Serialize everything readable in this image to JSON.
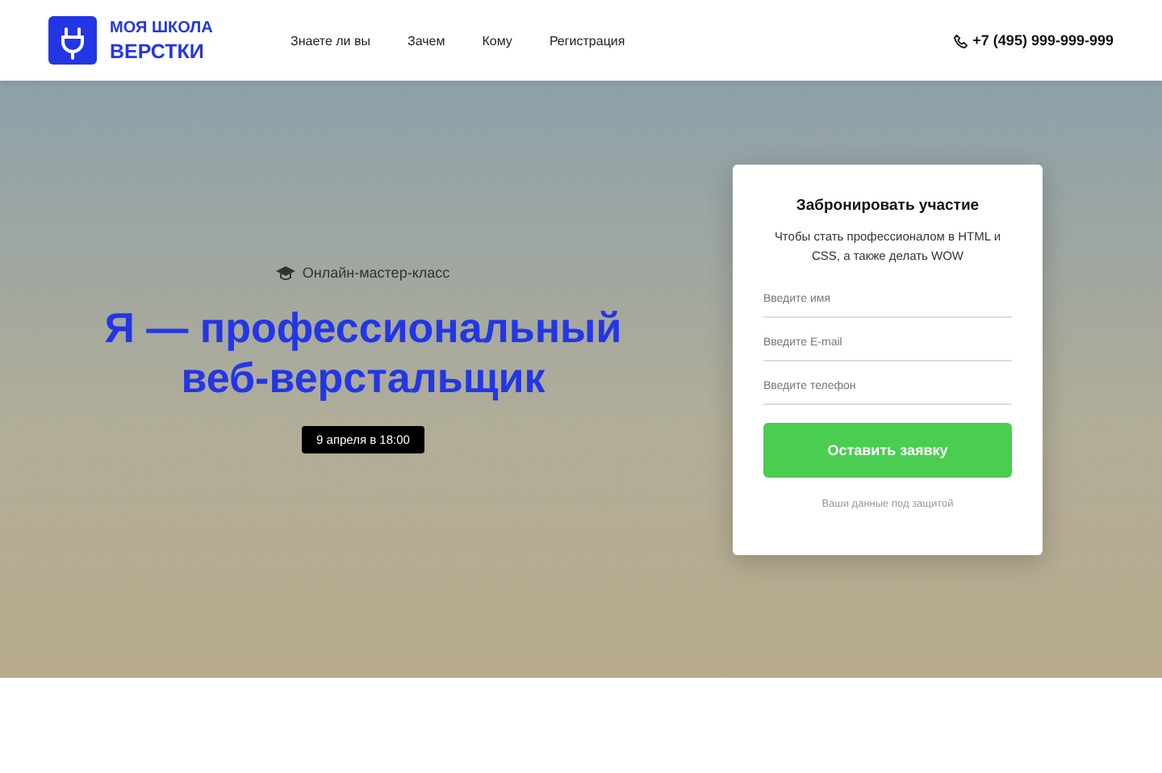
{
  "logo": {
    "line1": "МОЯ ШКОЛА",
    "line2": "ВЕРСТКИ"
  },
  "nav": [
    "Знаете ли вы",
    "Зачем",
    "Кому",
    "Регистрация"
  ],
  "phone": "+7 (495) 999-999-999",
  "hero": {
    "kicker": "Онлайн-мастер-класс",
    "title_line1": "Я — профессиональный",
    "title_line2": "веб-верстальщик",
    "date": "9 апреля в 18:00"
  },
  "form": {
    "title": "Забронировать участие",
    "subtitle": "Чтобы стать профессионалом в HTML и CSS, а также делать WOW",
    "fields": [
      {
        "placeholder": "Введите имя"
      },
      {
        "placeholder": "Введите E-mail"
      },
      {
        "placeholder": "Введите телефон"
      }
    ],
    "button": "Оставить заявку",
    "note": "Ваши данные под защитой"
  }
}
